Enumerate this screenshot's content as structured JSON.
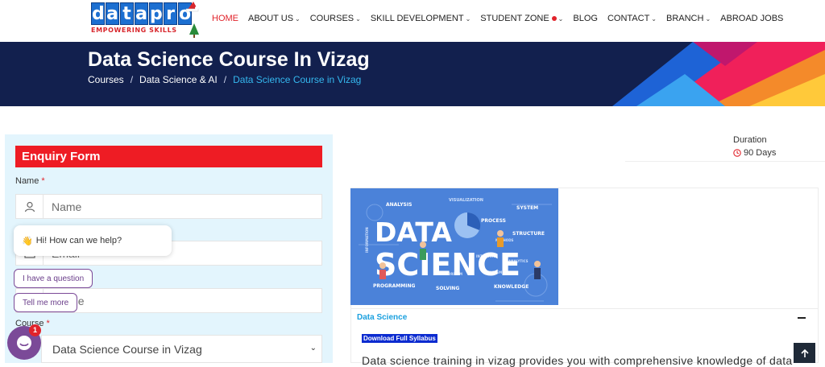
{
  "brand": {
    "logo_text": "datapro",
    "tagline": "EMPOWERING SKILLS"
  },
  "nav": {
    "items": [
      {
        "label": "HOME",
        "active": true,
        "caret": false
      },
      {
        "label": "ABOUT US",
        "caret": true
      },
      {
        "label": "COURSES",
        "caret": true
      },
      {
        "label": "SKILL DEVELOPMENT",
        "caret": true
      },
      {
        "label": "STUDENT ZONE",
        "caret": true,
        "dot": true
      },
      {
        "label": "BLOG",
        "caret": false
      },
      {
        "label": "CONTACT",
        "caret": true
      },
      {
        "label": "BRANCH",
        "caret": true
      },
      {
        "label": "ABROAD JOBS",
        "caret": false
      }
    ]
  },
  "banner": {
    "title": "Data Science Course In Vizag",
    "breadcrumb": [
      "Courses",
      "Data Science & AI",
      "Data Science Course in Vizag"
    ],
    "separator": "/"
  },
  "form": {
    "heading": "Enquiry Form",
    "name_label": "Name",
    "name_placeholder": "Name",
    "email_placeholder": "Email",
    "phone_placeholder": "Phone",
    "course_label": "Course",
    "course_value": "Data Science Course in Vizag",
    "required_mark": "*"
  },
  "chat": {
    "greeting": "Hi! How can we help?",
    "wave_emoji": "👋",
    "options": [
      "I have a question",
      "Tell me more"
    ],
    "badge_count": "1"
  },
  "course": {
    "duration_label": "Duration",
    "duration_value": "90 Days",
    "image_words": {
      "big_line1": "DATA",
      "big_line2": "SCIENCE",
      "keywords": [
        "ANALYSIS",
        "VISUALIZATION",
        "SYSTEM",
        "PROCESS",
        "STRUCTURE",
        "PROGRAMMING",
        "SOLVING",
        "KNOWLEDGE",
        "INFORMATION",
        "METHODS",
        "INTUITION",
        "ANALYTICS",
        "ALGORITHM",
        "SYSTEM"
      ]
    },
    "section_title": "Data Science",
    "syllabus_link": "Download Full Syllabus",
    "description": "Data science training in vizag provides you with comprehensive knowledge of data"
  },
  "colors": {
    "accent_red": "#ee1c24",
    "banner_navy": "#12204e",
    "link_blue": "#35b8ef",
    "panel_bg": "#e3f5fd",
    "chat_purple": "#7b4a98"
  }
}
